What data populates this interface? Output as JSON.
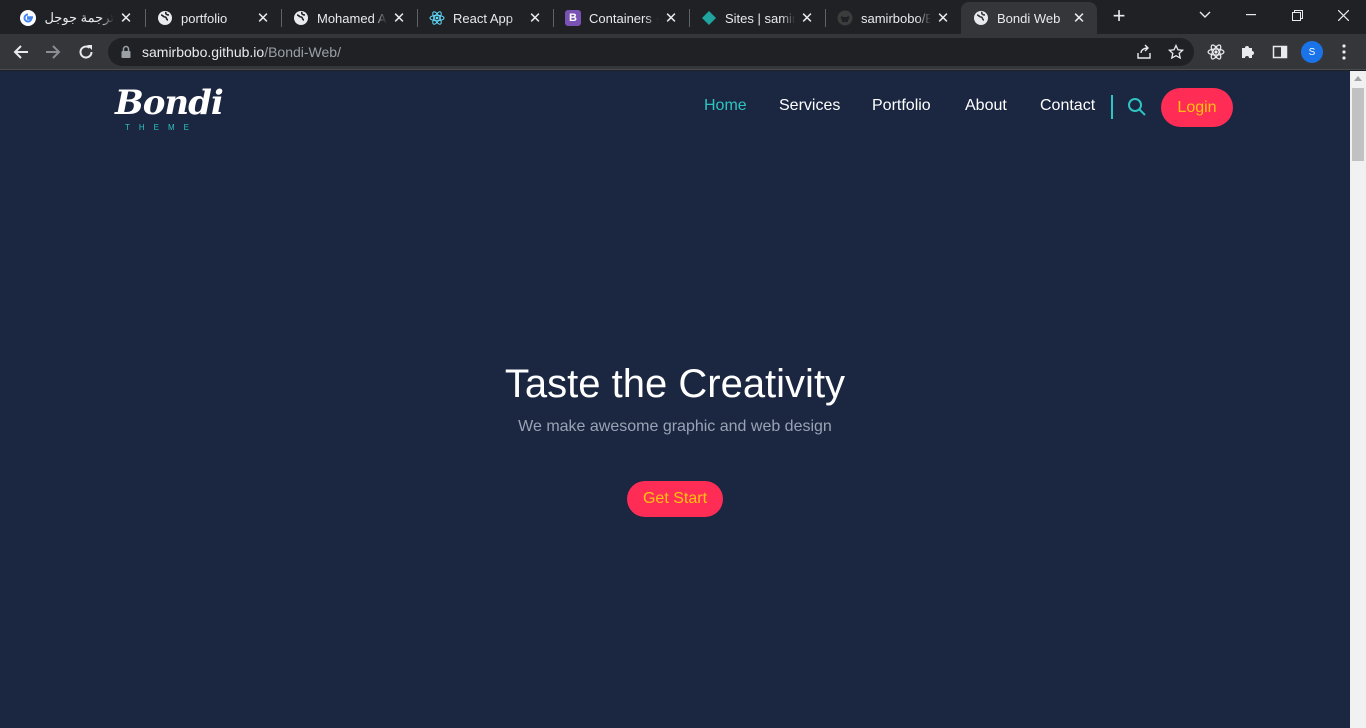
{
  "browser": {
    "tabs": [
      {
        "title": "ترجمة جوجل -",
        "favicon": "google-icon",
        "active": false
      },
      {
        "title": "portfolio",
        "favicon": "globe-icon",
        "active": false
      },
      {
        "title": "Mohamed At",
        "favicon": "globe-icon",
        "active": false
      },
      {
        "title": "React App",
        "favicon": "react-icon",
        "active": false
      },
      {
        "title": "Containers · B",
        "favicon": "bootstrap-icon",
        "active": false
      },
      {
        "title": "Sites | samirb",
        "favicon": "netlify-icon",
        "active": false
      },
      {
        "title": "samirbobo/Bo",
        "favicon": "github-icon",
        "active": false
      },
      {
        "title": "Bondi Web",
        "favicon": "globe-icon",
        "active": true
      }
    ],
    "url": {
      "host": "samirbobo.github.io",
      "path": "/Bondi-Web/"
    },
    "profile_initial": "S"
  },
  "site": {
    "logo": {
      "word": "Bondi",
      "sub": "THEME"
    },
    "nav": [
      "Home",
      "Services",
      "Portfolio",
      "About",
      "Contact"
    ],
    "active_nav": "Home",
    "login_label": "Login",
    "hero": {
      "title": "Taste the Creativity",
      "subtitle": "We make awesome graphic and web design",
      "cta": "Get Start"
    }
  },
  "colors": {
    "page_bg": "#1b2641",
    "accent_teal": "#2ec4c0",
    "button_bg": "#ff2d55",
    "button_text": "#ffc20e"
  }
}
